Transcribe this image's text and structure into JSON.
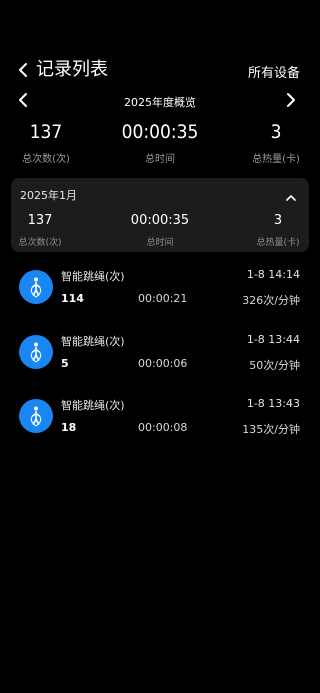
{
  "header": {
    "title": "记录列表",
    "all_devices": "所有设备"
  },
  "year_nav": {
    "label": "2025年度概览"
  },
  "summary": [
    {
      "value": "137",
      "label": "总次数(次)"
    },
    {
      "value": "00:00:35",
      "label": "总时间"
    },
    {
      "value": "3",
      "label": "总热量(卡)"
    }
  ],
  "month": {
    "title": "2025年1月",
    "stats": [
      {
        "value": "137",
        "label": "总次数(次)"
      },
      {
        "value": "00:00:35",
        "label": "总时间"
      },
      {
        "value": "3",
        "label": "总热量(卡)"
      }
    ]
  },
  "records": [
    {
      "name": "智能跳绳(次)",
      "time": "1-8 14:14",
      "count": "114",
      "duration": "00:00:21",
      "rate": "326次/分钟"
    },
    {
      "name": "智能跳绳(次)",
      "time": "1-8 13:44",
      "count": "5",
      "duration": "00:00:06",
      "rate": "50次/分钟"
    },
    {
      "name": "智能跳绳(次)",
      "time": "1-8 13:43",
      "count": "18",
      "duration": "00:00:08",
      "rate": "135次/分钟"
    }
  ],
  "icons": {
    "back": "chevron-left-icon",
    "prev": "chevron-left-icon",
    "next": "chevron-right-icon",
    "collapse": "chevron-up-icon",
    "record": "jump-rope-icon"
  },
  "colors": {
    "background": "#000000",
    "card": "#1c1c1e",
    "accent": "#1a86f4"
  }
}
